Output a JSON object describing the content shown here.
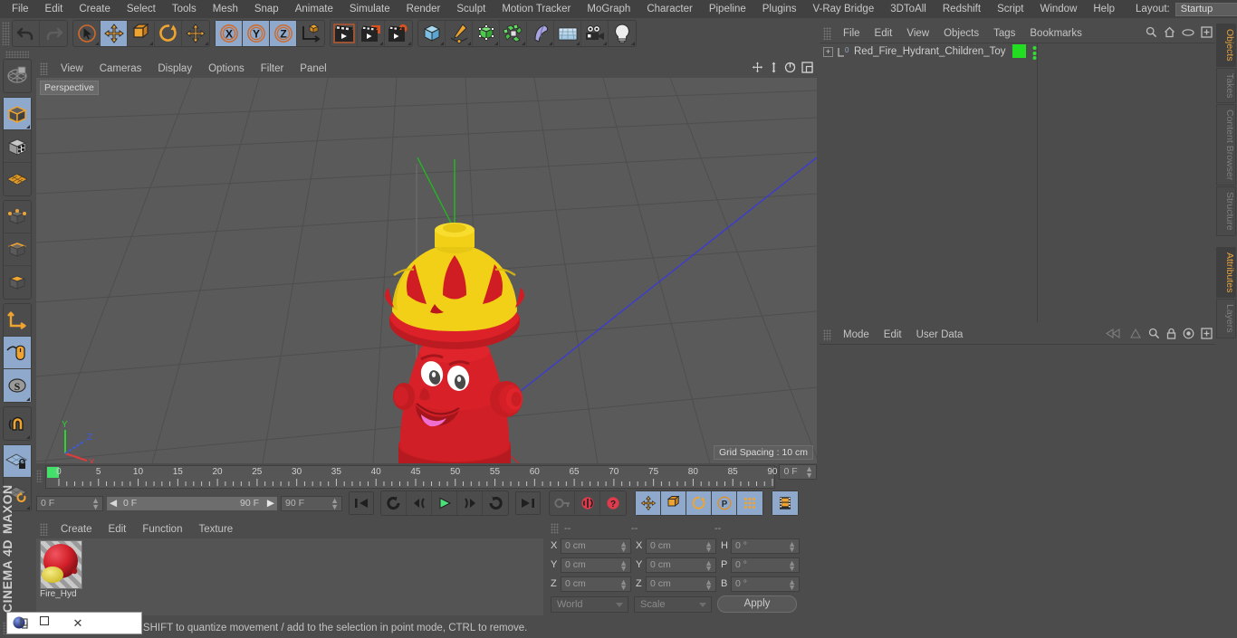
{
  "menubar": {
    "items": [
      "File",
      "Edit",
      "Create",
      "Select",
      "Tools",
      "Mesh",
      "Snap",
      "Animate",
      "Simulate",
      "Render",
      "Sculpt",
      "Motion Tracker",
      "MoGraph",
      "Character",
      "Pipeline",
      "Plugins",
      "V-Ray Bridge",
      "3DToAll",
      "Redshift",
      "Script",
      "Window",
      "Help"
    ],
    "layout_label": "Layout:",
    "layout_value": "Startup",
    "search_icon": "search-icon"
  },
  "toolbar": {
    "groups": [
      {
        "name": "history",
        "buttons": [
          {
            "name": "undo-button",
            "icon": "undo-icon",
            "selected": false
          },
          {
            "name": "redo-button",
            "icon": "redo-icon",
            "selected": false
          }
        ]
      },
      {
        "name": "transform-tools",
        "buttons": [
          {
            "name": "live-selection-tool",
            "icon": "cursor-circle-icon",
            "selected": false
          },
          {
            "name": "move-tool",
            "icon": "move-arrows-icon",
            "selected": true
          },
          {
            "name": "scale-tool",
            "icon": "scale-box-icon",
            "selected": false
          },
          {
            "name": "rotate-tool",
            "icon": "rotate-arc-icon",
            "selected": false
          },
          {
            "name": "move-tool-2",
            "icon": "move-arrows-icon",
            "selected": false
          }
        ]
      },
      {
        "name": "axis-locks",
        "buttons": [
          {
            "name": "lock-x-axis",
            "icon": "x-axis-icon",
            "label": "X",
            "selected": true
          },
          {
            "name": "lock-y-axis",
            "icon": "y-axis-icon",
            "label": "Y",
            "selected": true
          },
          {
            "name": "lock-z-axis",
            "icon": "z-axis-icon",
            "label": "Z",
            "selected": true
          },
          {
            "name": "world-object-coords",
            "icon": "world-axis-cube-icon",
            "selected": false
          }
        ]
      },
      {
        "name": "render-tools",
        "buttons": [
          {
            "name": "render-view-button",
            "icon": "render-clapper-icon",
            "selected": false
          },
          {
            "name": "render-to-picture-viewer-button",
            "icon": "render-clapper-window-icon",
            "selected": false
          },
          {
            "name": "render-settings-button",
            "icon": "render-clapper-gear-icon",
            "selected": false
          }
        ]
      },
      {
        "name": "create-objects",
        "buttons": [
          {
            "name": "add-primitive-cube-button",
            "icon": "blue-cube-icon",
            "selected": false
          },
          {
            "name": "add-spline-button",
            "icon": "pen-spline-icon",
            "selected": false
          },
          {
            "name": "add-generator-button",
            "icon": "green-cube-icon",
            "selected": false
          },
          {
            "name": "add-array-button",
            "icon": "green-array-icon",
            "selected": false
          },
          {
            "name": "add-deformer-button",
            "icon": "bend-deformer-icon",
            "selected": false
          },
          {
            "name": "add-environment-button",
            "icon": "floor-grid-icon",
            "selected": false
          },
          {
            "name": "add-camera-button",
            "icon": "camera-icon",
            "selected": false
          },
          {
            "name": "add-light-button",
            "icon": "light-bulb-icon",
            "selected": false
          }
        ]
      }
    ]
  },
  "leftbar": {
    "groups": [
      {
        "buttons": [
          {
            "name": "uv-texture-tool",
            "icon": "uv-sphere-icon",
            "selected": false
          }
        ]
      },
      {
        "buttons": [
          {
            "name": "model-mode",
            "icon": "model-cube-icon",
            "selected": true
          },
          {
            "name": "texture-mode",
            "icon": "texture-checker-cube-icon",
            "selected": false
          },
          {
            "name": "workplane-mode",
            "icon": "workplane-grid-icon",
            "selected": false
          }
        ]
      },
      {
        "buttons": [
          {
            "name": "points-mode",
            "icon": "points-cube-icon",
            "selected": false
          },
          {
            "name": "edges-mode",
            "icon": "edges-cube-icon",
            "selected": false
          },
          {
            "name": "polygons-mode",
            "icon": "polygons-cube-icon",
            "selected": false
          }
        ]
      },
      {
        "buttons": [
          {
            "name": "axis-modify-mode",
            "icon": "axis-corner-icon",
            "selected": false
          },
          {
            "name": "enable-snapping",
            "icon": "mouse-curve-icon",
            "selected": true
          },
          {
            "name": "soft-selection",
            "icon": "soft-selection-s-icon",
            "selected": true
          }
        ]
      },
      {
        "buttons": [
          {
            "name": "magnet-tool",
            "icon": "magnet-icon",
            "selected": false
          }
        ]
      },
      {
        "buttons": [
          {
            "name": "lock-workplane",
            "icon": "workplane-lock-icon",
            "selected": true
          },
          {
            "name": "planar-workplane",
            "icon": "workplane-rotate-icon",
            "selected": false
          }
        ]
      }
    ],
    "brand": "CINEMA 4D",
    "brand_top": "MAXON"
  },
  "viewport": {
    "menu": [
      "View",
      "Cameras",
      "Display",
      "Options",
      "Filter",
      "Panel"
    ],
    "nav_icons": [
      "pan-icon",
      "dolly-icon",
      "orbit-icon",
      "maximize-icon"
    ],
    "label": "Perspective",
    "grid_spacing": "Grid Spacing : 10 cm",
    "axes": {
      "x": "X",
      "y": "Y",
      "z": "Z"
    },
    "model": {
      "name": "fire-hydrant-toy",
      "colors": {
        "body": "#d81f26",
        "cap": "#f2d018",
        "mouth": "#ef6fd0",
        "eye_white": "#ffffff",
        "eye_pupil": "#3a3a3a"
      }
    }
  },
  "timeline": {
    "ticks": [
      0,
      5,
      10,
      15,
      20,
      25,
      30,
      35,
      40,
      45,
      50,
      55,
      60,
      65,
      70,
      75,
      80,
      85,
      90
    ],
    "current_frame_field": "0 F",
    "range_start": "0 F",
    "range_end": "90 F",
    "end_frame_field": "90 F",
    "right_frame_field": "0 F",
    "playback": [
      {
        "name": "go-to-start-button",
        "icon": "skip-start-icon"
      },
      {
        "name": "previous-keyframe-button",
        "icon": "rewind-loop-icon"
      },
      {
        "name": "previous-frame-button",
        "icon": "step-back-icon"
      },
      {
        "name": "play-button",
        "icon": "play-icon"
      },
      {
        "name": "next-frame-button",
        "icon": "step-forward-icon"
      },
      {
        "name": "next-keyframe-button",
        "icon": "forward-loop-icon"
      },
      {
        "name": "go-to-end-button",
        "icon": "skip-end-icon"
      }
    ],
    "record": [
      {
        "name": "record-active-objects-button",
        "icon": "key-icon",
        "selected": false
      },
      {
        "name": "autokeying-button",
        "icon": "red-circle-arrow-icon",
        "selected": false
      },
      {
        "name": "keyframe-selection-button",
        "icon": "red-question-icon",
        "selected": false
      }
    ],
    "anim_toggles": [
      {
        "name": "position-keys-toggle",
        "icon": "move-arrows-icon",
        "selected": true
      },
      {
        "name": "scale-keys-toggle",
        "icon": "scale-box-icon",
        "selected": true
      },
      {
        "name": "rotation-keys-toggle",
        "icon": "rotate-arc-icon",
        "selected": true
      },
      {
        "name": "parameter-keys-toggle",
        "icon": "param-p-icon",
        "selected": true
      },
      {
        "name": "point-level-animation-toggle",
        "icon": "pla-dots-icon",
        "selected": true
      }
    ],
    "filmstrip": {
      "name": "timeline-view-button",
      "icon": "filmstrip-icon",
      "selected": true
    }
  },
  "materials": {
    "menu": [
      "Create",
      "Edit",
      "Function",
      "Texture"
    ],
    "items": [
      {
        "name": "Fire_Hyd",
        "preview_colors": {
          "main": "#d22029",
          "accent": "#e8d44a"
        }
      }
    ]
  },
  "coordinates": {
    "headers": [
      "--",
      "--",
      "--"
    ],
    "rows": [
      {
        "pos_label": "X",
        "pos_value": "0 cm",
        "size_label": "X",
        "size_value": "0 cm",
        "rot_label": "H",
        "rot_value": "0 °"
      },
      {
        "pos_label": "Y",
        "pos_value": "0 cm",
        "size_label": "Y",
        "size_value": "0 cm",
        "rot_label": "P",
        "rot_value": "0 °"
      },
      {
        "pos_label": "Z",
        "pos_value": "0 cm",
        "size_label": "Z",
        "size_value": "0 cm",
        "rot_label": "B",
        "rot_value": "0 °"
      }
    ],
    "system_dropdown": "World",
    "mode_dropdown": "Scale",
    "apply_label": "Apply"
  },
  "objects": {
    "menu": [
      "File",
      "Edit",
      "View",
      "Objects",
      "Tags",
      "Bookmarks"
    ],
    "header_icons": [
      "search-icon",
      "home-icon",
      "eye-icon",
      "add-layer-icon"
    ],
    "items": [
      {
        "name": "Red_Fire_Hydrant_Children_Toy",
        "layer_badge": "0",
        "tag_color": "#22dd22",
        "expander": "+"
      }
    ]
  },
  "attributes": {
    "menu": [
      "Mode",
      "Edit",
      "User Data"
    ],
    "header_icons": [
      "fold-left-icon",
      "fold-right-icon",
      "search-icon",
      "lock-icon",
      "target-icon",
      "add-icon"
    ]
  },
  "vtabs": {
    "top": [
      {
        "label": "Objects",
        "active": true
      },
      {
        "label": "Takes",
        "active": false
      },
      {
        "label": "Content Browser",
        "active": false
      },
      {
        "label": "Structure",
        "active": false
      }
    ],
    "bottom": [
      {
        "label": "Attributes",
        "active": true
      },
      {
        "label": "Layers",
        "active": false
      }
    ]
  },
  "statusbar": {
    "text": "move elements. Hold down SHIFT to quantize movement / add to the selection in point mode, CTRL to remove."
  },
  "mini_window": {
    "icon": "app-icon",
    "restore_label": "❐",
    "minimize_label": "□",
    "close_label": "✕"
  },
  "colors": {
    "accent_orange": "#e8a33d",
    "selection_blue": "#8fa9cc",
    "panel_bg": "#4c4c4c",
    "viewport_bg": "#5a5a5a"
  }
}
